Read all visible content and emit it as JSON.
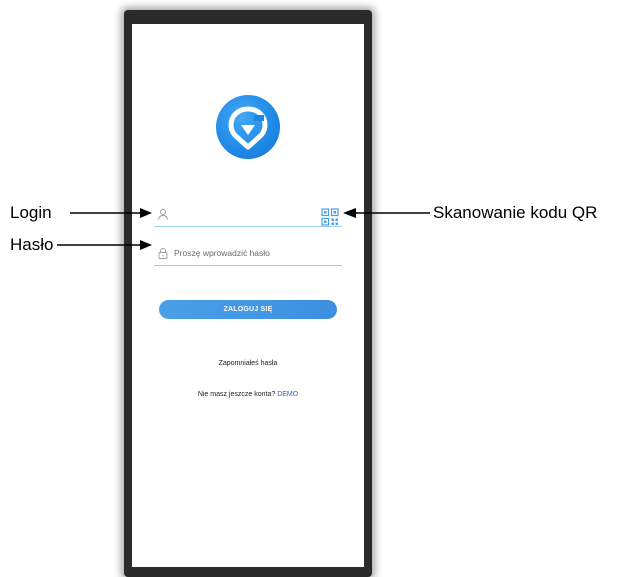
{
  "annotations": {
    "login": "Login",
    "password": "Hasło",
    "qr_scan": "Skanowanie kodu QR"
  },
  "form": {
    "login_placeholder": "",
    "password_placeholder": "Proszę wprowadzić hasło",
    "login_button": "ZALOGUJ SIĘ",
    "forgot_password": "Zapomniałeś hasła",
    "no_account_text": "Nie masz jeszcze konta?",
    "demo_link": "DEMO"
  },
  "icons": {
    "logo": "app-logo-g-pin",
    "login_field": "user-icon",
    "password_field": "lock-icon",
    "qr": "qr-code-icon"
  },
  "colors": {
    "accent": "#1e88e5",
    "button": "#4a9fe8",
    "link": "#2b60c9",
    "field_underline": "#9fd0f0"
  }
}
